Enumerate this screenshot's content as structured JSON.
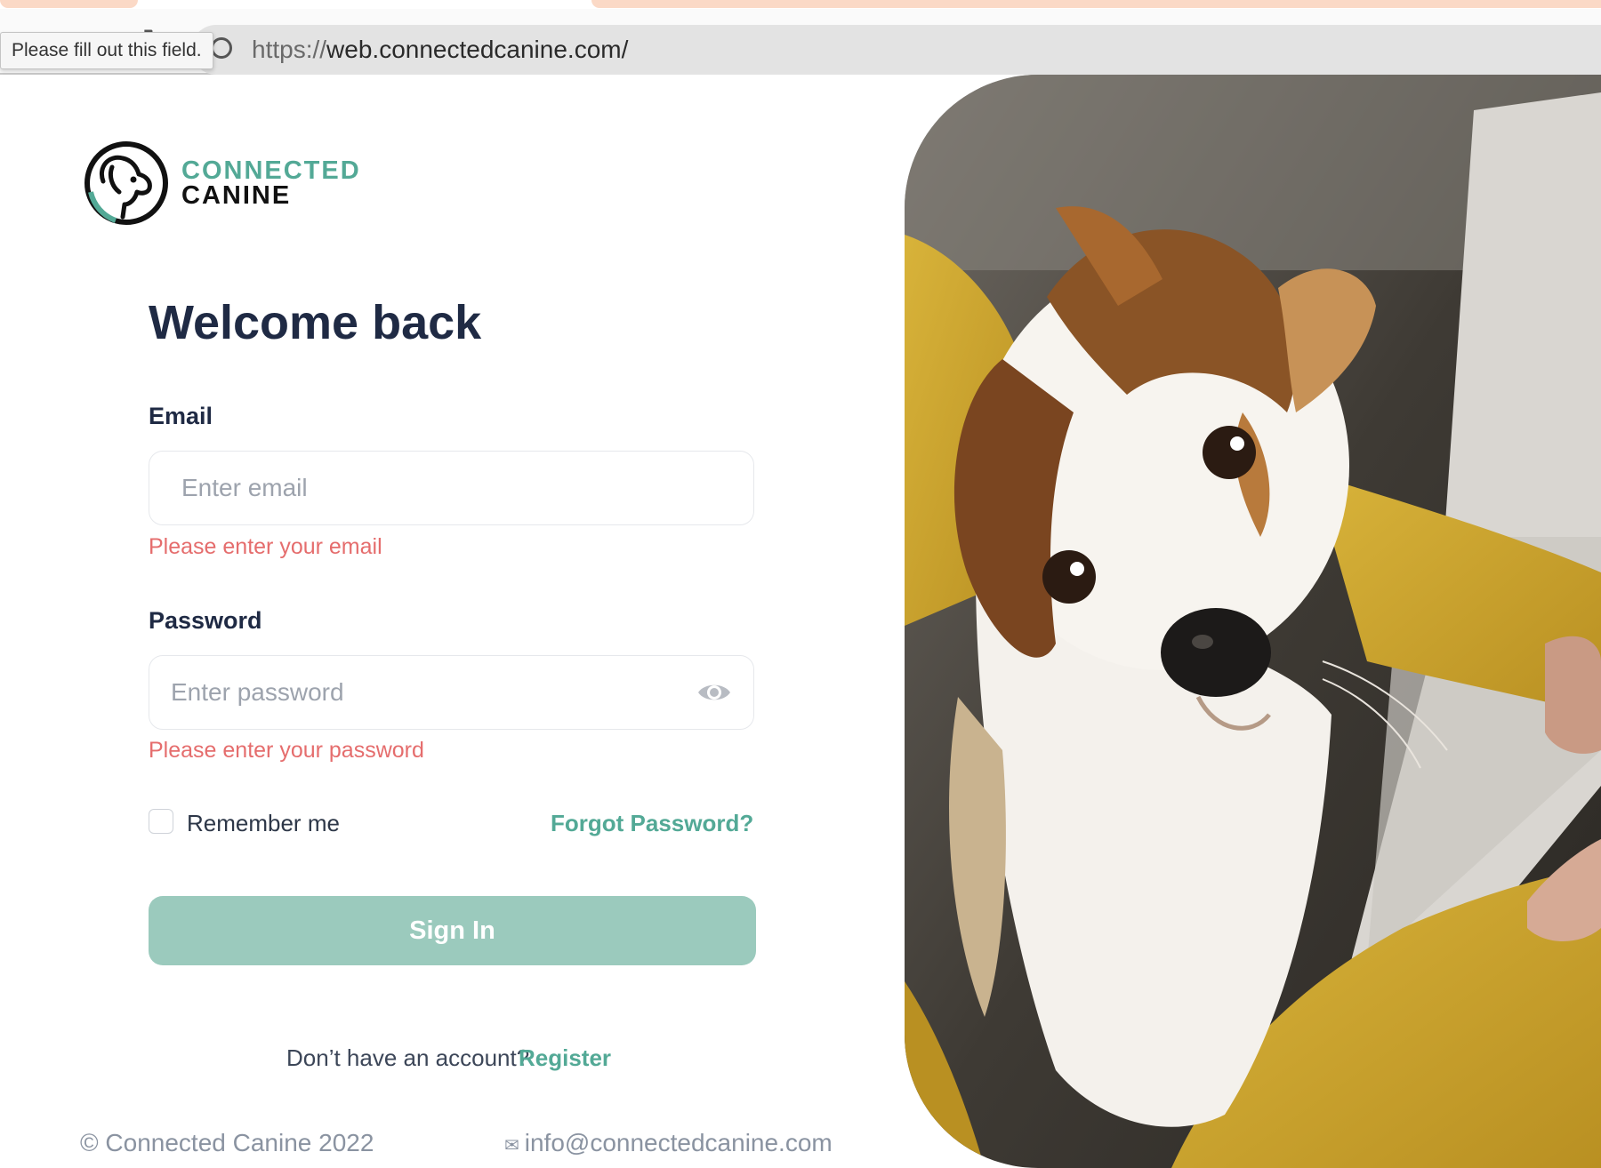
{
  "browser": {
    "url_scheme": "https://",
    "url_host": "web.connectedcanine.com/",
    "tooltip": "Please fill out this field."
  },
  "brand": {
    "line1": "CONNECTED",
    "line2": "CANINE",
    "accent": "#53a996",
    "button_color": "#9bcabd",
    "error_color": "#e56d6d"
  },
  "form": {
    "title": "Welcome back",
    "email_label": "Email",
    "email_placeholder": "Enter email",
    "email_value": "",
    "email_error": "Please enter your email",
    "password_label": "Password",
    "password_placeholder": "Enter password",
    "password_value": "",
    "password_error": "Please enter your password",
    "remember_label": "Remember me",
    "remember_checked": false,
    "forgot_label": "Forgot Password?",
    "signin_label": "Sign In",
    "no_account_text": "Don’t have an account?",
    "register_label": "Register"
  },
  "footer": {
    "copyright": "© Connected Canine 2022",
    "email": "info@connectedcanine.com",
    "email_icon": "envelope-icon"
  },
  "hero": {
    "image_icon": "dog-photo"
  }
}
